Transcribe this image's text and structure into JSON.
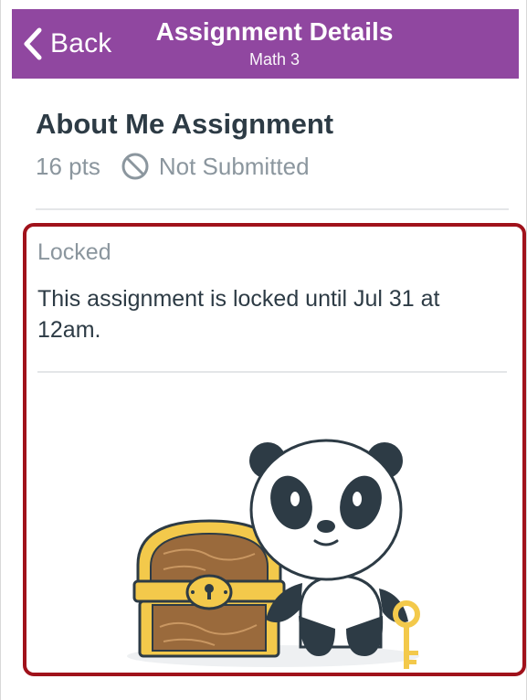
{
  "header": {
    "back_label": "Back",
    "title": "Assignment Details",
    "subtitle": "Math 3",
    "background_color": "#9047a0"
  },
  "assignment": {
    "title": "About Me Assignment",
    "points": "16 pts",
    "status": "Not Submitted",
    "status_icon": "no-entry-icon"
  },
  "locked": {
    "heading": "Locked",
    "message": "This assignment is locked until Jul 31 at 12am.",
    "highlight_color": "#a0121b",
    "illustration": "panda-with-treasure-chest-and-key"
  }
}
